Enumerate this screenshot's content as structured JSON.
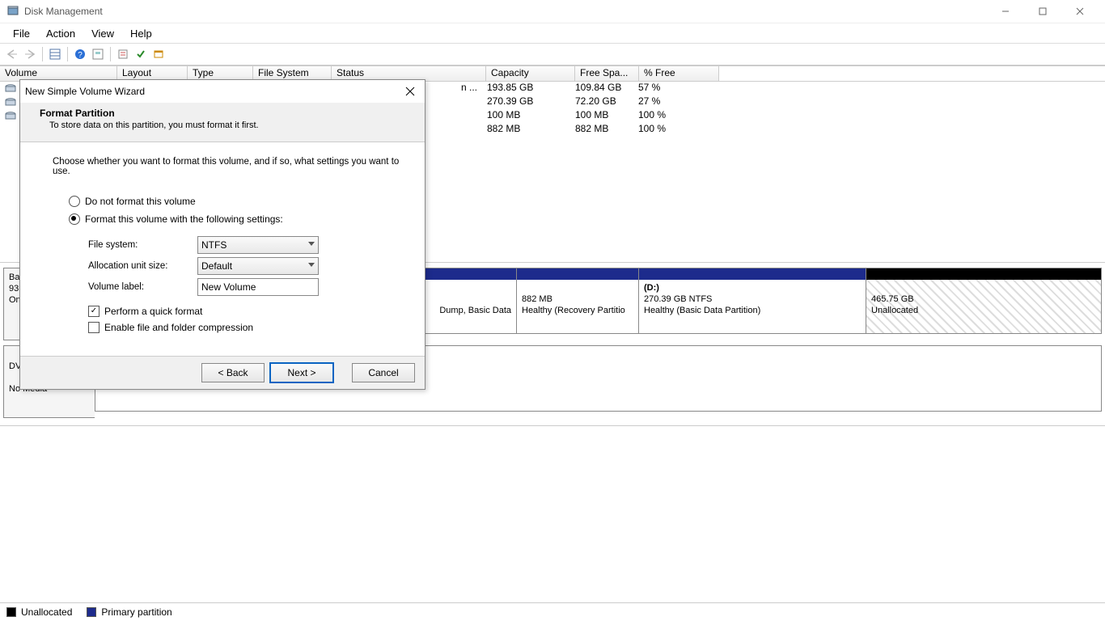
{
  "app_title": "Disk Management",
  "menu": [
    "File",
    "Action",
    "View",
    "Help"
  ],
  "columns": {
    "volume": "Volume",
    "layout": "Layout",
    "type": "Type",
    "filesystem": "File System",
    "status": "Status",
    "capacity": "Capacity",
    "freespace": "Free Spa...",
    "pctfree": "% Free"
  },
  "col_widths": {
    "volume": 132,
    "layout": 74,
    "type": 68,
    "filesystem": 84,
    "status": 178,
    "capacity": 97,
    "freespace": 66,
    "pctfree": 86
  },
  "vol_rows": [
    {
      "status_suffix": "n ...",
      "capacity": "193.85 GB",
      "free": "109.84 GB",
      "pct": "57 %"
    },
    {
      "status_suffix": "",
      "capacity": "270.39 GB",
      "free": "72.20 GB",
      "pct": "27 %"
    },
    {
      "status_suffix": "",
      "capacity": "100 MB",
      "free": "100 MB",
      "pct": "100 %"
    },
    {
      "status_suffix": "",
      "capacity": "882 MB",
      "free": "882 MB",
      "pct": "100 %"
    }
  ],
  "disk_labels": {
    "d0_line1": "Ba",
    "d0_line2": "93",
    "d0_line3": "On",
    "d1_line1": "",
    "d1_line2": "DV",
    "d1_line3": "",
    "d1_line4": "No Media"
  },
  "partitions": {
    "p_dump": {
      "line1": "",
      "line2": "",
      "line3": "Dump, Basic Data"
    },
    "p_recovery": {
      "line1": "",
      "line2": "882 MB",
      "line3": "Healthy (Recovery Partitio"
    },
    "p_d": {
      "line1": "(D:)",
      "line2": "270.39 GB NTFS",
      "line3": "Healthy (Basic Data Partition)"
    },
    "p_unalloc": {
      "line1": "",
      "line2": "465.75 GB",
      "line3": "Unallocated"
    }
  },
  "legend": {
    "unalloc": "Unallocated",
    "primary": "Primary partition"
  },
  "wizard": {
    "title": "New Simple Volume Wizard",
    "section": "Format Partition",
    "section_sub": "To store data on this partition, you must format it first.",
    "intro": "Choose whether you want to format this volume, and if so, what settings you want to use.",
    "opt_noformat": "Do not format this volume",
    "opt_format": "Format this volume with the following settings:",
    "lbl_fs": "File system:",
    "val_fs": "NTFS",
    "lbl_alloc": "Allocation unit size:",
    "val_alloc": "Default",
    "lbl_label": "Volume label:",
    "val_label": "New Volume",
    "chk_quick": "Perform a quick format",
    "chk_compress": "Enable file and folder compression",
    "btn_back": "< Back",
    "btn_next": "Next >",
    "btn_cancel": "Cancel"
  }
}
